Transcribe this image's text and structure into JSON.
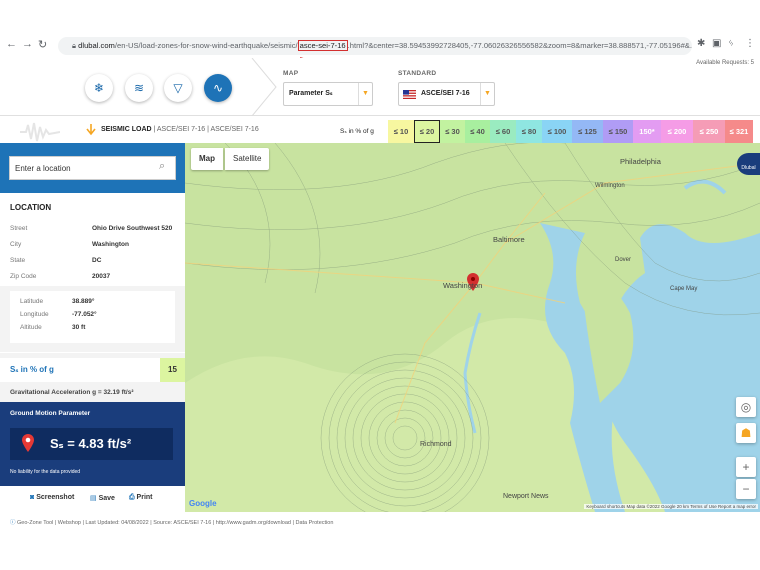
{
  "browser": {
    "url_domain": "dlubal.com",
    "url_before": "/en-US/load-zones-for-snow-wind-earthquake/seismic/",
    "url_highlight": "asce-sei-7-16",
    "url_after": ".html?&center=38.59453992728405,-77.06026326556582&zoom=8&marker=38.888571,-77.05196#&..."
  },
  "header": {
    "available_requests": "Available Requests: 5",
    "map_label": "MAP",
    "map_select": "Parameter Sₛ",
    "standard_label": "STANDARD",
    "standard_select": "ASCE/SEI 7-16",
    "hazards": [
      "snowflake-icon",
      "wind-icon",
      "tornado-icon",
      "seismic-icon"
    ]
  },
  "legend": {
    "seismic_load": "SEISMIC LOAD",
    "breadcrumb_1": "ASCE/SEI 7-16",
    "breadcrumb_2": "ASCE/SEI 7-16",
    "unit": "Sₛ in % of g",
    "cells": [
      {
        "label": "≤ 10",
        "color": "#f7f7a0"
      },
      {
        "label": "≤ 20",
        "color": "#dcf5a0"
      },
      {
        "label": "≤ 30",
        "color": "#c2f2a0"
      },
      {
        "label": "≤ 40",
        "color": "#a8ef9f"
      },
      {
        "label": "≤ 60",
        "color": "#9aebc0"
      },
      {
        "label": "≤ 80",
        "color": "#8fe6e1"
      },
      {
        "label": "≤ 100",
        "color": "#8ad4f5"
      },
      {
        "label": "≤ 125",
        "color": "#94b8f5"
      },
      {
        "label": "≤ 150",
        "color": "#b09cf5"
      },
      {
        "label": "150*",
        "color": "#e39cf2"
      },
      {
        "label": "≤ 200",
        "color": "#f59ce6"
      },
      {
        "label": "≤ 250",
        "color": "#f59cb6"
      },
      {
        "label": "≤ 321",
        "color": "#f58a8a"
      }
    ],
    "selected_index": 1
  },
  "sidebar": {
    "search_placeholder": "Enter a location",
    "location_title": "LOCATION",
    "street_label": "Street",
    "street_value": "Ohio Drive Southwest 520",
    "city_label": "City",
    "city_value": "Washington",
    "state_label": "State",
    "state_value": "DC",
    "zip_label": "Zip Code",
    "zip_value": "20037",
    "lat_label": "Latitude",
    "lat_value": "38.889°",
    "lon_label": "Longitude",
    "lon_value": "-77.052°",
    "alt_label": "Altitude",
    "alt_value": "30 ft",
    "ss_label": "Sₛ in % of g",
    "ss_value": "15",
    "grav": "Gravitational Acceleration g = 32.19 ft/s²",
    "gm_title": "Ground Motion Parameter",
    "gm_value": "Sₛ = 4.83 ft/s²",
    "liability": "No liability for the data provided",
    "screenshot": "Screenshot",
    "save": "Save",
    "print": "Print"
  },
  "map": {
    "tab_map": "Map",
    "tab_satellite": "Satellite",
    "labels": [
      "Philadelphia",
      "Wilmington",
      "Baltimore",
      "Washington",
      "Richmond",
      "Newport News",
      "Cape May",
      "Dover"
    ],
    "attribution": "Keyboard shortcuts   Map data ©2022 Google   20 km   Terms of Use   Report a map error",
    "google": "Google"
  },
  "footer": "Geo-Zone Tool  |  Webshop  |  Last Updated: 04/08/2022  |  Source: ASCE/SEI 7-16  |  http://www.gadm.org/download  |  Data Protection"
}
